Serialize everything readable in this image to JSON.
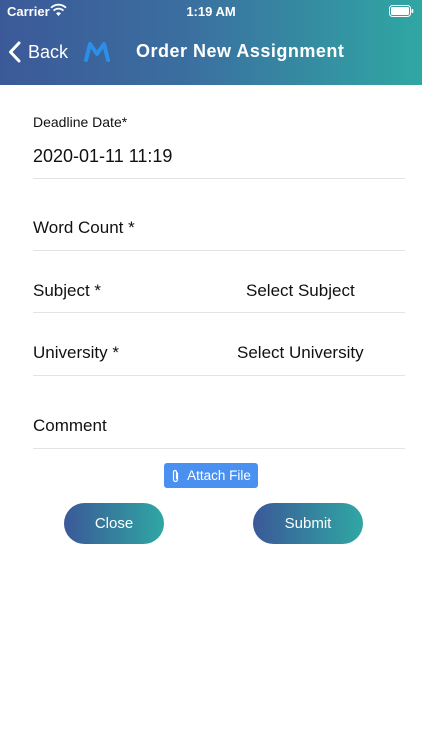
{
  "status_bar": {
    "carrier": "Carrier",
    "time": "1:19 AM"
  },
  "nav": {
    "back_label": "Back",
    "title": "Order New Assignment"
  },
  "form": {
    "deadline": {
      "label": "Deadline Date*",
      "value": "2020-01-11 11:19"
    },
    "word_count": {
      "label": "Word Count *"
    },
    "subject": {
      "label": "Subject *",
      "select": "Select Subject"
    },
    "university": {
      "label": "University *",
      "select": "Select University"
    },
    "comment": {
      "label": "Comment"
    }
  },
  "actions": {
    "attach_label": "Attach File",
    "close_label": "Close",
    "submit_label": "Submit"
  },
  "colors": {
    "header_gradient_start": "#3b5998",
    "header_gradient_end": "#2fa7a3",
    "attach_button": "#4a90f0"
  },
  "icons": [
    "wifi-icon",
    "battery-icon",
    "chevron-left-icon",
    "app-logo-icon",
    "paperclip-icon"
  ]
}
